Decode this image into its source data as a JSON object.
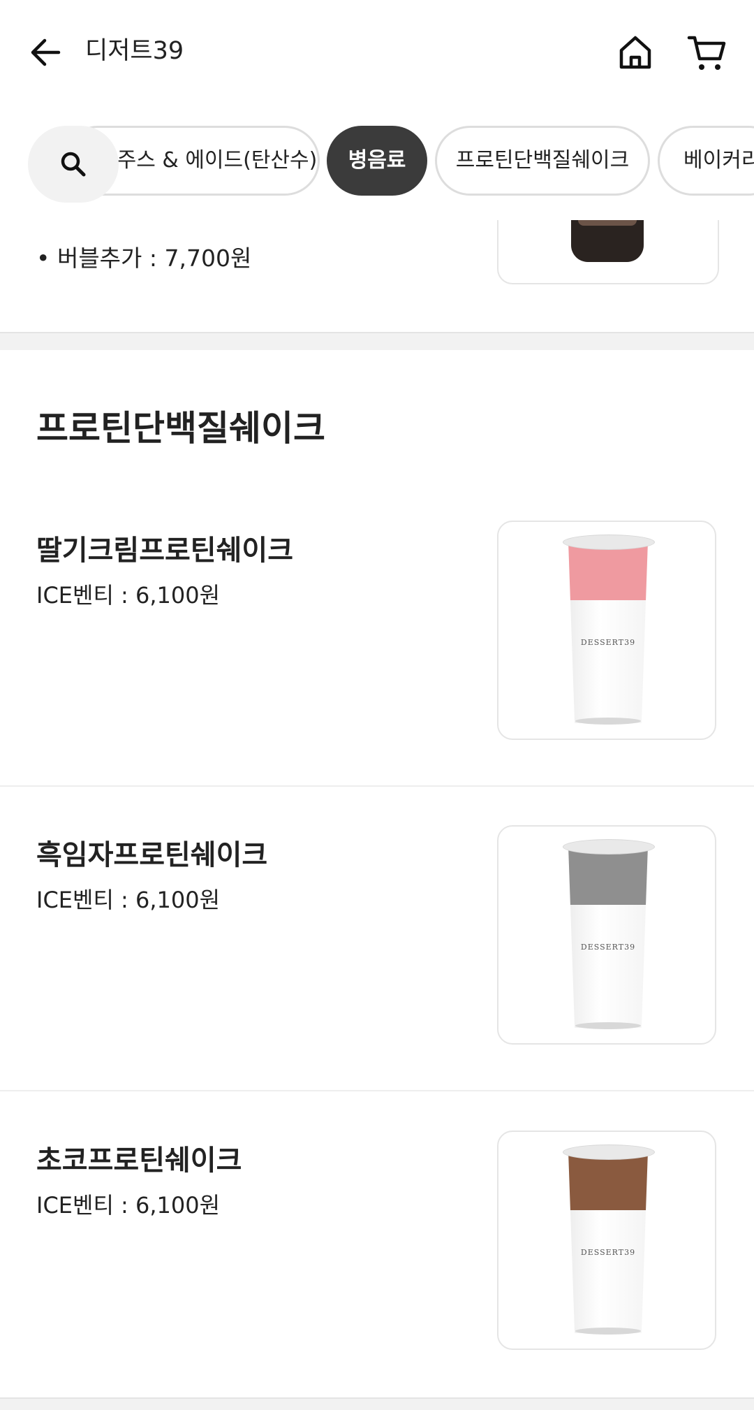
{
  "header": {
    "title": "디저트39",
    "icons": {
      "back": "arrow-left-icon",
      "home": "home-icon",
      "cart": "cart-icon"
    }
  },
  "category_tabs": {
    "search_icon": "search-icon",
    "items": [
      {
        "label": "주스 & 에이드(탄산수)",
        "active": false
      },
      {
        "label": "병음료",
        "active": true
      },
      {
        "label": "프로틴단백질쉐이크",
        "active": false
      },
      {
        "label": "베이커리",
        "active": false
      }
    ]
  },
  "previous_item": {
    "option_line": "• 버블추가 : 7,700원"
  },
  "section": {
    "title": "프로틴단백질쉐이크",
    "items": [
      {
        "name": "딸기크림프로틴쉐이크",
        "price": "ICE벤티 : 6,100원",
        "topping_color": "#ef9aa0",
        "brand_mark": "DESSERT39"
      },
      {
        "name": "흑임자프로틴쉐이크",
        "price": "ICE벤티 : 6,100원",
        "topping_color": "#8f8f8f",
        "brand_mark": "DESSERT39"
      },
      {
        "name": "초코프로틴쉐이크",
        "price": "ICE벤티 : 6,100원",
        "topping_color": "#8a5a3f",
        "brand_mark": "DESSERT39"
      }
    ]
  },
  "colors": {
    "active_tab": "#3b3b3b",
    "tab_border": "#dddddd",
    "search_bg": "#f2f2f2",
    "text": "#222222"
  }
}
